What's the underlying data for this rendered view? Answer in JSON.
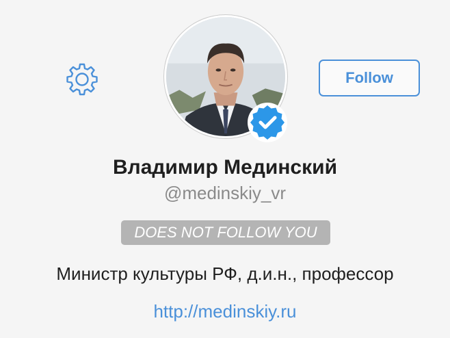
{
  "profile": {
    "name": "Владимир Мединский",
    "handle": "@medinskiy_vr",
    "follow_status": "DOES NOT FOLLOW YOU",
    "bio": "Министр культуры РФ, д.и.н., профессор",
    "url": "http://medinskiy.ru",
    "verified": true
  },
  "actions": {
    "follow_label": "Follow"
  },
  "icons": {
    "settings": "gear-icon",
    "verified": "verified-badge-icon",
    "avatar": "profile-photo"
  },
  "colors": {
    "accent": "#4a90d9",
    "background": "#f5f5f5",
    "badge_bg": "#b4b4b4",
    "name_text": "#1f1f1f",
    "handle_text": "#8a8a8a"
  }
}
